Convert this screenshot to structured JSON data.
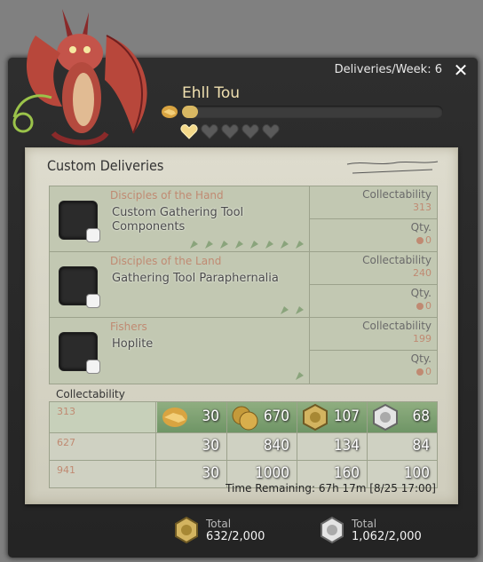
{
  "window": {
    "deliveries_per_week": "Deliveries/Week: 6"
  },
  "npc": {
    "name": "Ehll Tou",
    "relationship_level": 0.06,
    "hearts_filled": 1,
    "hearts_total": 5
  },
  "paper": {
    "title": "Custom Deliveries"
  },
  "entries": [
    {
      "category": "Disciples of the Hand",
      "name": "Custom Gathering Tool Components",
      "collectability_label": "Collectability",
      "collectability": "313",
      "qty_label": "Qty.",
      "qty": "0",
      "class_icons": [
        "hammer-icon",
        "needle-icon",
        "anvil-icon",
        "mortar-icon",
        "shield-icon",
        "leaf-icon",
        "flask-icon",
        "pot-icon"
      ]
    },
    {
      "category": "Disciples of the Land",
      "name": "Gathering Tool Paraphernalia",
      "collectability_label": "Collectability",
      "collectability": "240",
      "qty_label": "Qty.",
      "qty": "0",
      "class_icons": [
        "pickaxe-icon",
        "leaf-icon"
      ]
    },
    {
      "category": "Fishers",
      "name": "Hoplite",
      "collectability_label": "Collectability",
      "collectability": "199",
      "qty_label": "Qty.",
      "qty": "0",
      "class_icons": [
        "fish-icon"
      ]
    }
  ],
  "rewards": {
    "header": "Collectability",
    "icons": [
      "handshake-icon",
      "gil-coins-icon",
      "yellow-scrip-icon",
      "white-scrip-icon"
    ],
    "rows": [
      {
        "threshold": "313",
        "values": [
          "30",
          "670",
          "107",
          "68"
        ]
      },
      {
        "threshold": "627",
        "values": [
          "30",
          "840",
          "134",
          "84"
        ]
      },
      {
        "threshold": "941",
        "values": [
          "30",
          "1000",
          "160",
          "100"
        ]
      }
    ]
  },
  "time_remaining": "Time Remaining: 67h 17m [8/25 17:00]",
  "totals": [
    {
      "label": "Total",
      "value": "632/2,000",
      "icon": "yellow-scrip-icon"
    },
    {
      "label": "Total",
      "value": "1,062/2,000",
      "icon": "white-scrip-icon"
    }
  ],
  "colors": {
    "accent": "#d9b862",
    "category_text": "#c08a72",
    "band": "#7fa172"
  }
}
